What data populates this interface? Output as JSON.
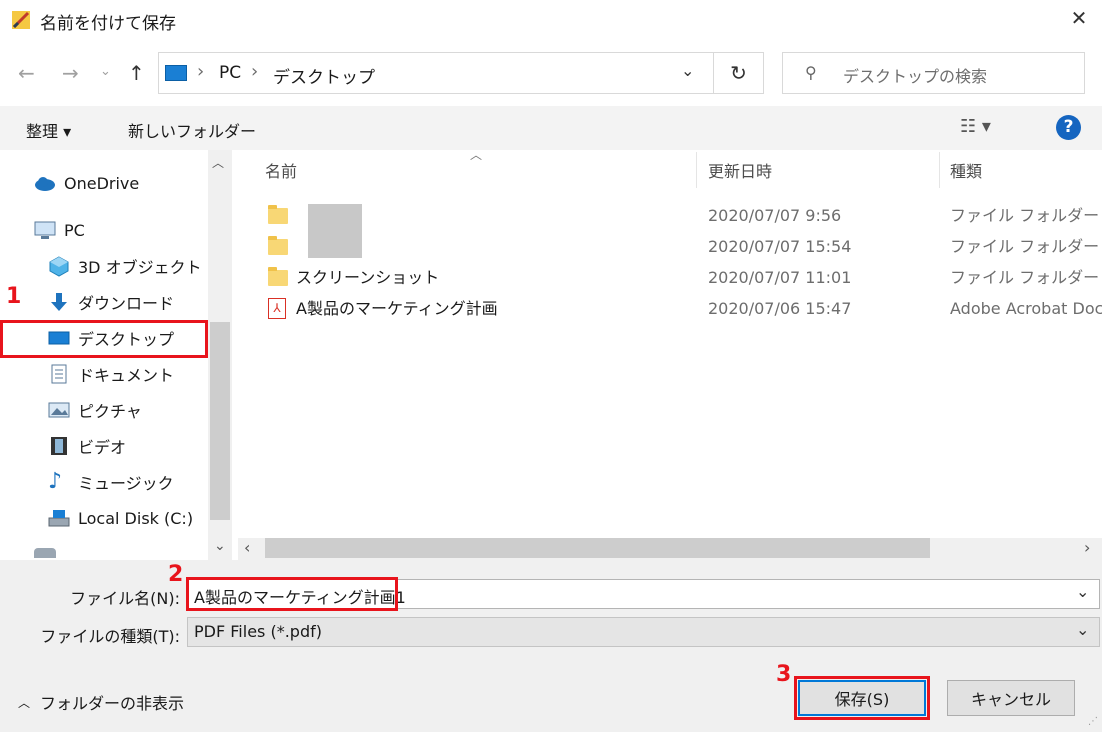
{
  "window": {
    "title": "名前を付けて保存",
    "close_glyph": "✕"
  },
  "address": {
    "breadcrumb": [
      "PC",
      "デスクトップ"
    ],
    "sep": "›",
    "search_placeholder": "デスクトップの検索"
  },
  "toolbar": {
    "organize": "整理 ▾",
    "new_folder": "新しいフォルダー",
    "help": "?"
  },
  "nav": {
    "items": [
      {
        "label": "OneDrive"
      },
      {
        "label": "PC"
      },
      {
        "label": "3D オブジェクト"
      },
      {
        "label": "ダウンロード"
      },
      {
        "label": "デスクトップ"
      },
      {
        "label": "ドキュメント"
      },
      {
        "label": "ピクチャ"
      },
      {
        "label": "ビデオ"
      },
      {
        "label": "ミュージック"
      },
      {
        "label": "Local Disk (C:)"
      }
    ]
  },
  "columns": {
    "name": "名前",
    "date": "更新日時",
    "type": "種類"
  },
  "files": [
    {
      "name": "",
      "date": "2020/07/07 9:56",
      "type": "ファイル フォルダー"
    },
    {
      "name": "",
      "date": "2020/07/07 15:54",
      "type": "ファイル フォルダー"
    },
    {
      "name": "スクリーンショット",
      "date": "2020/07/07 11:01",
      "type": "ファイル フォルダー"
    },
    {
      "name": "A製品のマーケティング計画",
      "date": "2020/07/06 15:47",
      "type": "Adobe Acrobat Doc"
    }
  ],
  "form": {
    "filename_label": "ファイル名(N):",
    "filename_value": "A製品のマーケティング計画1",
    "filetype_label": "ファイルの種類(T):",
    "filetype_value": "PDF Files (*.pdf)"
  },
  "footer": {
    "hide_folders": "フォルダーの非表示",
    "save": "保存(S)",
    "cancel": "キャンセル"
  },
  "annotations": {
    "n1": "1",
    "n2": "2",
    "n3": "3"
  },
  "colors": {
    "accent": "#0078d7",
    "annotation_red": "#e8141c",
    "help_blue": "#1565c0"
  }
}
